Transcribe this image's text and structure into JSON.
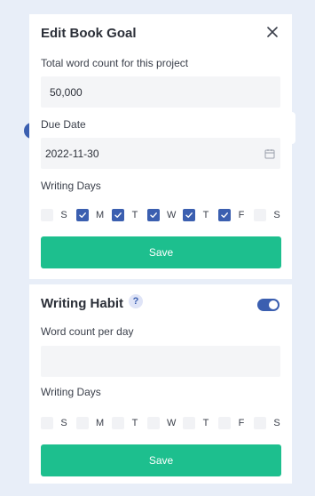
{
  "colors": {
    "page_background": "#e8eef8",
    "primary_blue": "#3b5fb0",
    "save_green": "#1dbf8e",
    "input_background": "#f4f5f7"
  },
  "book_goal": {
    "title": "Edit Book Goal",
    "close_icon": "close-icon",
    "word_count_label": "Total word count for this project",
    "word_count_value": "50,000",
    "due_date_label": "Due Date",
    "due_date_value": "2022-11-30",
    "calendar_icon": "calendar-icon",
    "writing_days_label": "Writing Days",
    "days": [
      {
        "letter": "S",
        "checked": false
      },
      {
        "letter": "M",
        "checked": true
      },
      {
        "letter": "T",
        "checked": true
      },
      {
        "letter": "W",
        "checked": true
      },
      {
        "letter": "T",
        "checked": true
      },
      {
        "letter": "F",
        "checked": true
      },
      {
        "letter": "S",
        "checked": false
      }
    ],
    "save_label": "Save"
  },
  "writing_habit": {
    "title": "Writing Habit",
    "help_icon_label": "?",
    "enabled": true,
    "word_count_label": "Word count per day",
    "word_count_value": "",
    "writing_days_label": "Writing Days",
    "days": [
      {
        "letter": "S",
        "checked": false
      },
      {
        "letter": "M",
        "checked": false
      },
      {
        "letter": "T",
        "checked": false
      },
      {
        "letter": "W",
        "checked": false
      },
      {
        "letter": "T",
        "checked": false
      },
      {
        "letter": "F",
        "checked": false
      },
      {
        "letter": "S",
        "checked": false
      }
    ],
    "save_label": "Save"
  }
}
